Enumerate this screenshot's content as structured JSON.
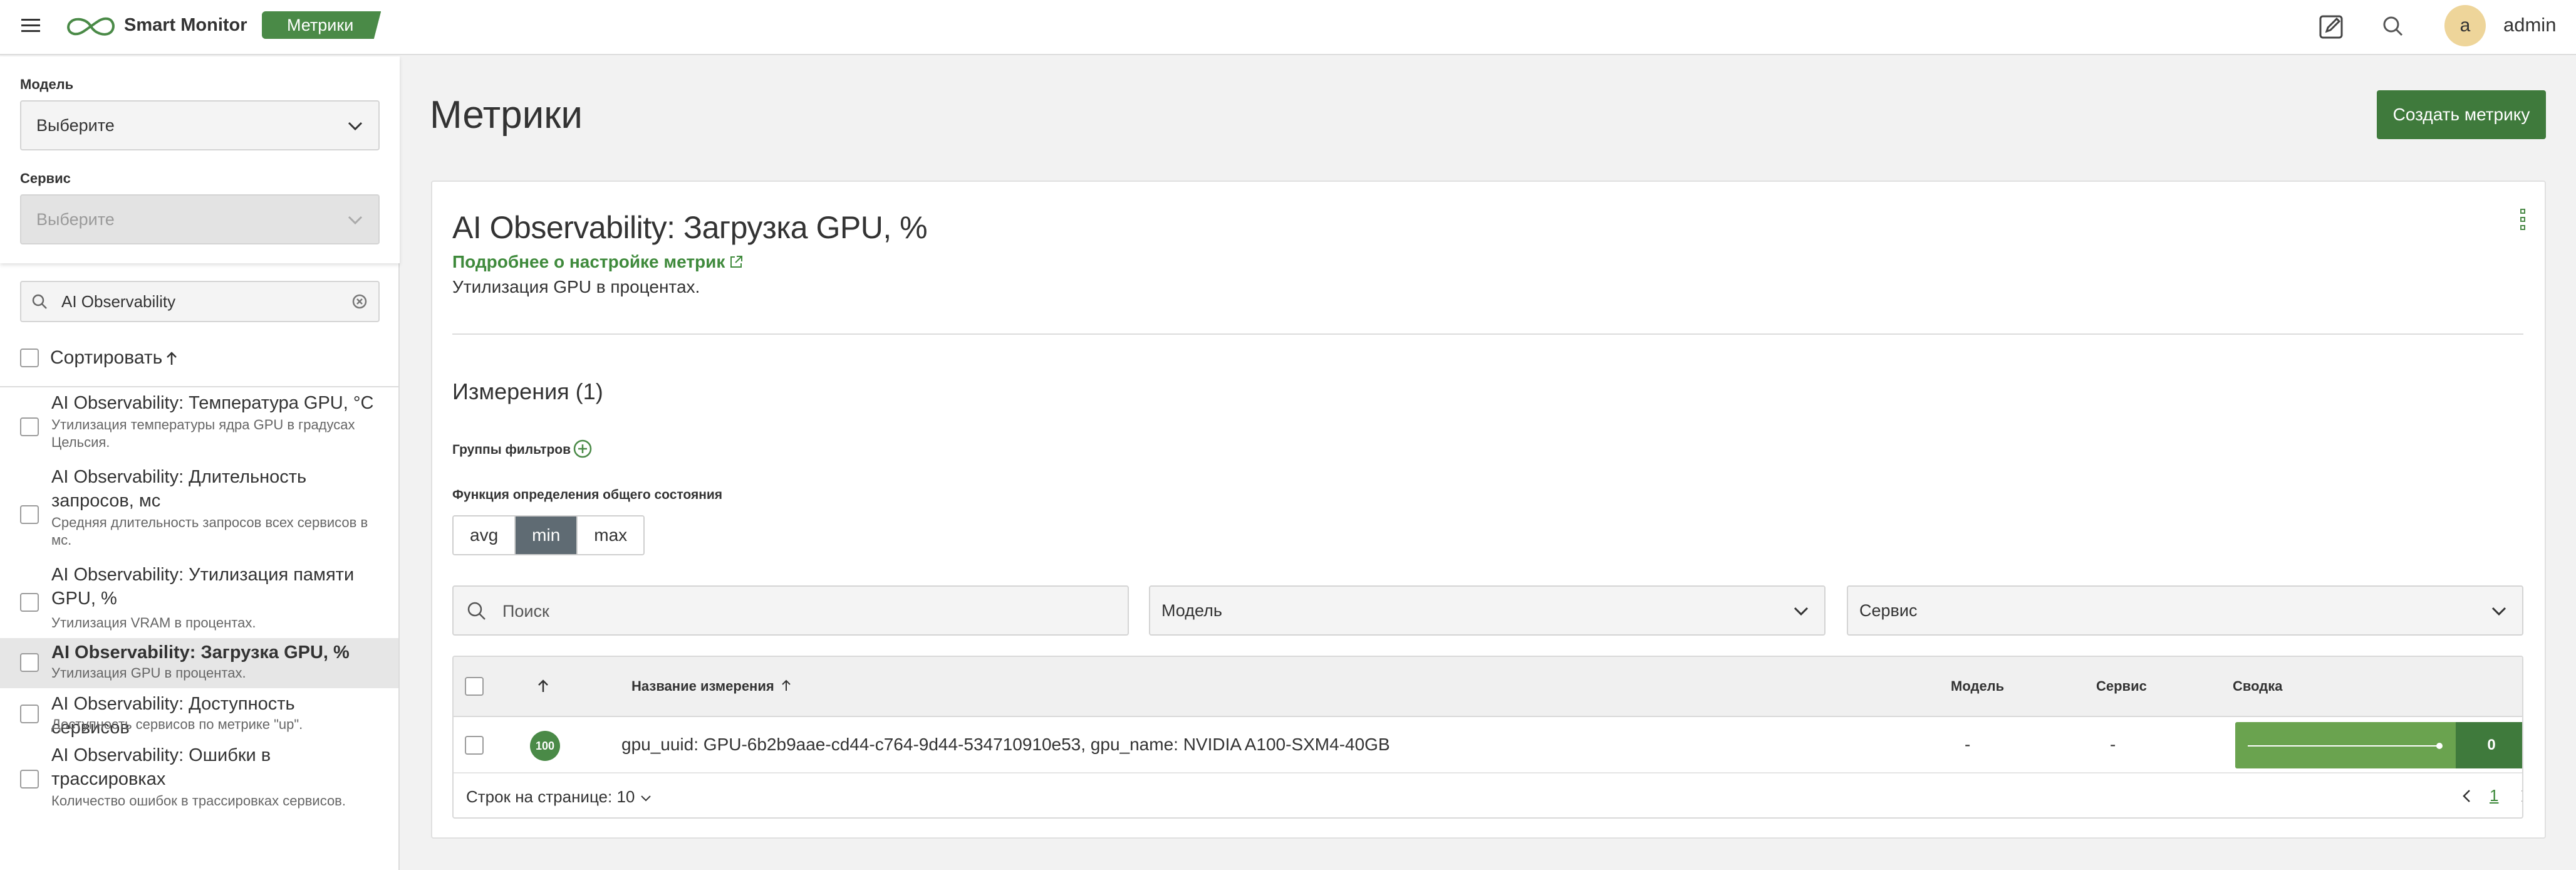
{
  "header": {
    "app_name": "Smart Monitor",
    "section_badge": "Метрики",
    "user_initial": "a",
    "username": "admin",
    "accent": "#4a8a47"
  },
  "sidebar": {
    "model_label": "Модель",
    "model_value": "Выберите",
    "service_label": "Сервис",
    "service_value": "Выберите",
    "search_value": "AI Observability",
    "sort_label": "Сортировать",
    "items": [
      {
        "title": "AI Observability: Температура GPU, °C",
        "desc": "Утилизация температуры ядра GPU в градусах Цельсия."
      },
      {
        "title": "AI Observability: Длительность запросов, мс",
        "desc": "Средняя длительность запросов всех сервисов в мс."
      },
      {
        "title": "AI Observability: Утилизация памяти GPU, %",
        "desc": "Утилизация VRAM в процентах."
      },
      {
        "title": "AI Observability: Загрузка GPU, %",
        "desc": "Утилизация GPU в процентах."
      },
      {
        "title": "AI Observability: Доступность сервисов",
        "desc": "Доступность сервисов по метрике \"up\"."
      },
      {
        "title": "AI Observability: Ошибки в трассировках",
        "desc": "Количество ошибок в трассировках сервисов."
      }
    ]
  },
  "main": {
    "page_title": "Метрики",
    "create_button": "Создать метрику",
    "card": {
      "title": "AI Observability: Загрузка GPU, %",
      "link": "Подробнее о настройке метрик",
      "description": "Утилизация GPU в процентах.",
      "dimensions_title": "Измерения (1)",
      "filter_groups_label": "Группы фильтров",
      "health_function_label": "Функция определения общего состояния",
      "health_options": [
        "avg",
        "min",
        "max"
      ],
      "health_selected": "min",
      "search_placeholder": "Поиск",
      "model_filter": "Модель",
      "service_filter": "Сервис",
      "table": {
        "columns": {
          "name": "Название измерения",
          "model": "Модель",
          "service": "Сервис",
          "summary": "Сводка"
        },
        "rows": [
          {
            "health": "100",
            "name": "gpu_uuid: GPU-6b2b9aae-cd44-c764-9d44-534710910e53, gpu_name: NVIDIA A100-SXM4-40GB",
            "model": "-",
            "service": "-",
            "summary_value": "0"
          }
        ],
        "rows_per_page": "Строк на странице: 10",
        "page": "1"
      }
    }
  }
}
